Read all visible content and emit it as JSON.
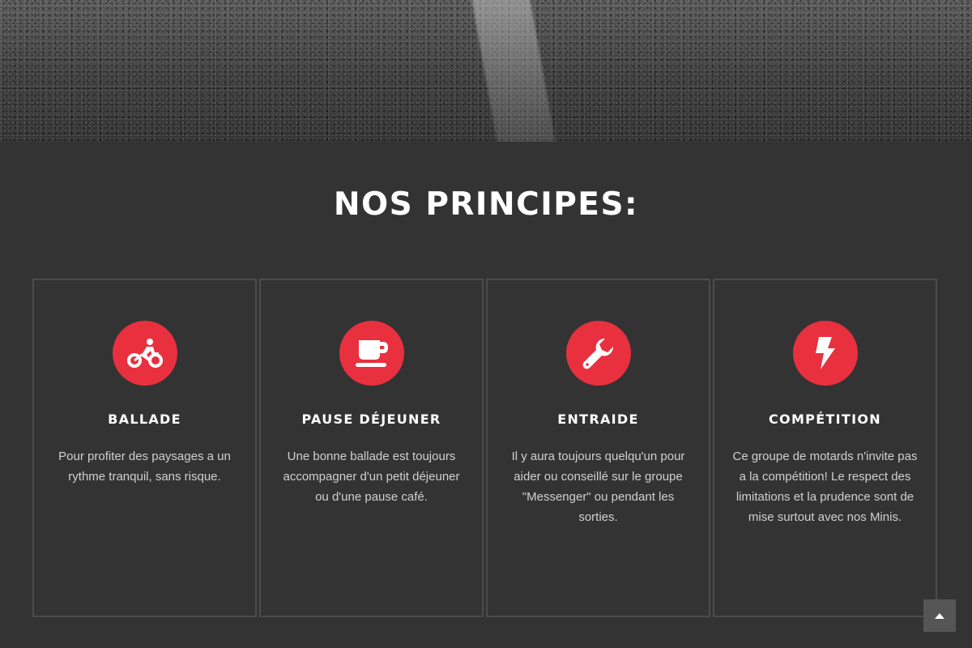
{
  "section": {
    "title": "NOS PRINCIPES:"
  },
  "cards": [
    {
      "icon": "motorcycle-icon",
      "title": "BALLADE",
      "text": "Pour profiter des paysages a un rythme tranquil, sans risque."
    },
    {
      "icon": "coffee-cup-icon",
      "title": "PAUSE DÉJEUNER",
      "text": "Une bonne ballade est toujours accompagner d'un petit déjeuner ou d'une pause café."
    },
    {
      "icon": "wrench-icon",
      "title": "ENTRAIDE",
      "text": "Il y aura toujours quelqu'un pour aider ou conseillé sur le groupe \"Messenger\" ou pendant les sorties."
    },
    {
      "icon": "lightning-icon",
      "title": "COMPÉTITION",
      "text": "Ce groupe de motards n'invite pas a la compétition! Le respect des limitations et la prudence sont de mise surtout avec nos Minis."
    }
  ],
  "colors": {
    "accent": "#e8303f",
    "background": "#333333",
    "card_border": "#4c4c4c"
  },
  "scroll_top": {
    "icon": "chevron-up-icon"
  }
}
